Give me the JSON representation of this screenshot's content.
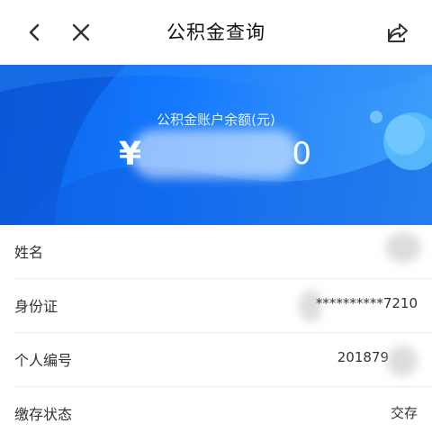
{
  "nav": {
    "title": "公积金查询",
    "back_icon": "chevron-left-icon",
    "close_icon": "close-icon",
    "share_icon": "share-icon"
  },
  "hero": {
    "label": "公积金账户余额(元)",
    "currency": "¥",
    "amount_tail": "0",
    "bg_color": "#1479ff"
  },
  "rows": [
    {
      "label": "姓名",
      "value": ""
    },
    {
      "label": "身份证",
      "value": "**********7210"
    },
    {
      "label": "个人编号",
      "value": "201879"
    },
    {
      "label": "缴存状态",
      "value": "交存"
    }
  ]
}
